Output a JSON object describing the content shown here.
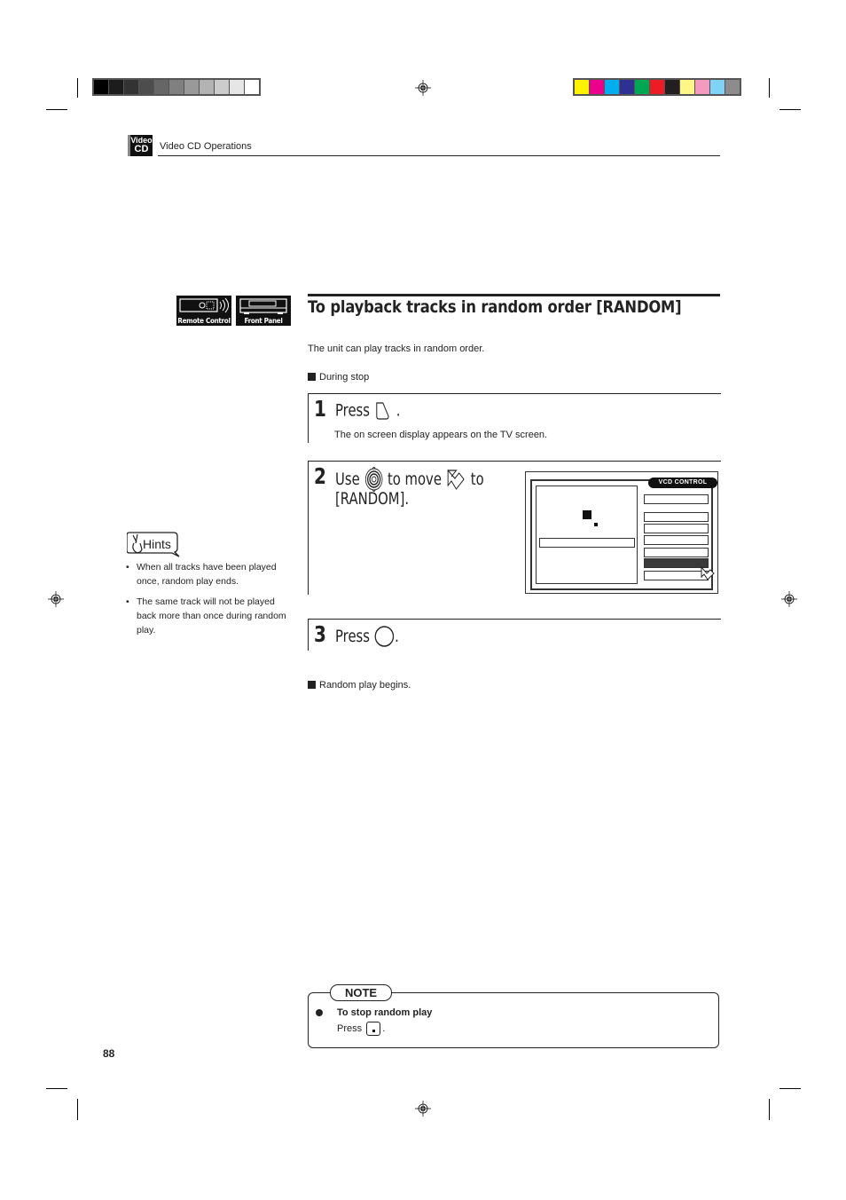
{
  "print_marks": {
    "grayscale_bar": [
      "#000000",
      "#1c1c1c",
      "#333333",
      "#4d4d4d",
      "#666666",
      "#808080",
      "#999999",
      "#b3b3b3",
      "#cccccc",
      "#e6e6e6",
      "#ffffff"
    ],
    "color_bar": [
      "#fff200",
      "#ec008c",
      "#00aeef",
      "#2e3192",
      "#00a651",
      "#ed1c24",
      "#231f20",
      "#fff685",
      "#f49ac1",
      "#7fd3f7",
      "#8c8c8c"
    ]
  },
  "header": {
    "badge_line1": "Video",
    "badge_line2": "CD",
    "section": "Video CD Operations"
  },
  "mode_icons": {
    "remote": "Remote Control",
    "front": "Front Panel"
  },
  "title": "To playback tracks in random order [RANDOM]",
  "intro": "The unit can play tracks in random order.",
  "condition": "During stop",
  "steps": [
    {
      "num": "1",
      "text_before": "Press",
      "text_after": ".",
      "sub": "The on screen display appears on the TV screen."
    },
    {
      "num": "2",
      "text_use": "Use",
      "text_move": "to move",
      "text_to": "to",
      "line2": "[RANDOM]."
    },
    {
      "num": "3",
      "text_before": "Press",
      "text_after": "."
    }
  ],
  "osd": {
    "tab_label": "VCD CONTROL",
    "selected_index": 5
  },
  "result": "Random play begins.",
  "hints": {
    "logo": "Hints",
    "items": [
      "When all tracks have been played once, random play ends.",
      "The same track will not be played back more than once during random play."
    ]
  },
  "note": {
    "tag": "NOTE",
    "heading": "To stop random play",
    "press": "Press",
    "after": "."
  },
  "page_number": "88"
}
